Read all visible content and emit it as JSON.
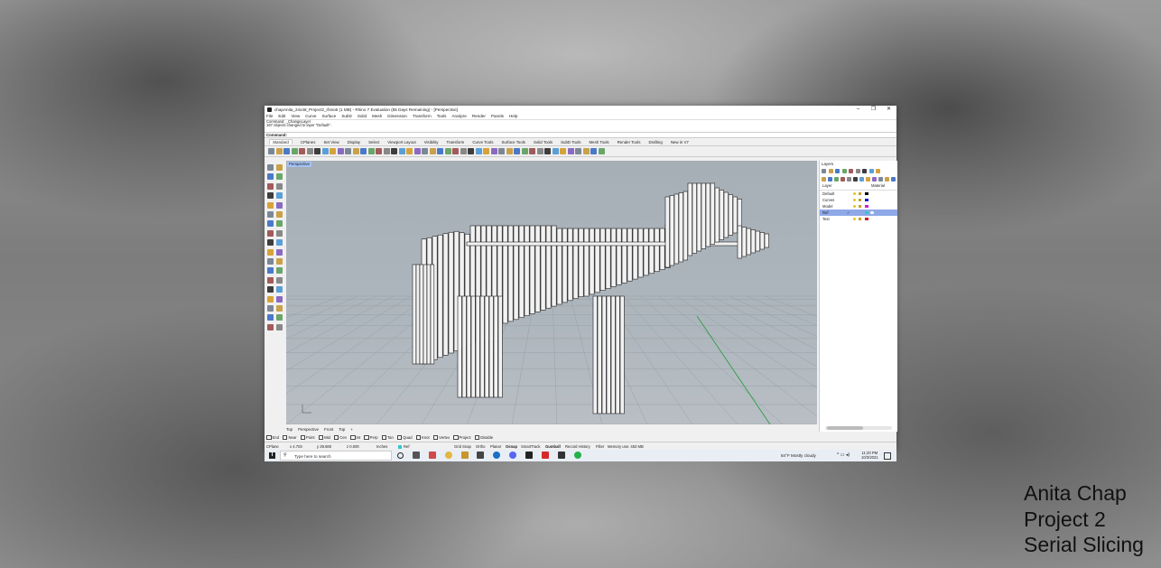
{
  "overlay": {
    "line1": "Anita Chap",
    "line2": "Project 2",
    "line3": "Serial Slicing"
  },
  "window": {
    "title": "chapAnita_24x48_Project2_rhino6 (1 MB) - Rhino 7 Evaluation (55 Days Remaining) - [Perspective]",
    "minimize": "–",
    "maximize": "❐",
    "close": "✕"
  },
  "menu": [
    "File",
    "Edit",
    "View",
    "Curve",
    "Surface",
    "SubD",
    "Solid",
    "Mesh",
    "Dimension",
    "Transform",
    "Tools",
    "Analyze",
    "Render",
    "Panels",
    "Help"
  ],
  "command": {
    "history": [
      "Command: _ChangeLayer",
      "167 objects changed to layer \"Default\"."
    ],
    "prompt": "Command:"
  },
  "toolbar_tabs": [
    "Standard",
    "CPlanes",
    "Set View",
    "Display",
    "Select",
    "Viewport Layout",
    "Visibility",
    "Transform",
    "Curve Tools",
    "Surface Tools",
    "Solid Tools",
    "SubD Tools",
    "Mesh Tools",
    "Render Tools",
    "Drafting",
    "New in V7"
  ],
  "viewport": {
    "label": "Perspective",
    "tabs": [
      "Top",
      "Perspective",
      "Front",
      "Top",
      "+"
    ]
  },
  "osnaps": [
    "End",
    "Near",
    "Point",
    "Mid",
    "Cen",
    "Int",
    "Perp",
    "Tan",
    "Quad",
    "Knot",
    "Vertex",
    "Project",
    "Disable"
  ],
  "status": {
    "cplane": "CPlane",
    "x": "x 4.703",
    "y": "y 39.680",
    "z": "z 0.000",
    "units": "Inches",
    "layer": "Ref",
    "items": [
      "Grid Snap",
      "Ortho",
      "Planar",
      "Osnap",
      "SmartTrack",
      "Gumball",
      "Record History",
      "Filter",
      "Memory use: 453 MB"
    ]
  },
  "layers": {
    "panel_title": "Layers",
    "col_layer": "Layer",
    "col_material": "Material",
    "rows": [
      {
        "name": "Default",
        "color": "#000000"
      },
      {
        "name": "Curves",
        "color": "#1f1fd0"
      },
      {
        "name": "Model",
        "color": "#d01fd0"
      },
      {
        "name": "Ref",
        "color": "#2fc8d0",
        "check": "✓"
      },
      {
        "name": "Text",
        "color": "#d02020"
      }
    ]
  },
  "taskbar": {
    "search": "Type here to search",
    "weather": "84°F  Mostly cloudy",
    "time": "11:20 PM",
    "date": "10/3/2021"
  }
}
